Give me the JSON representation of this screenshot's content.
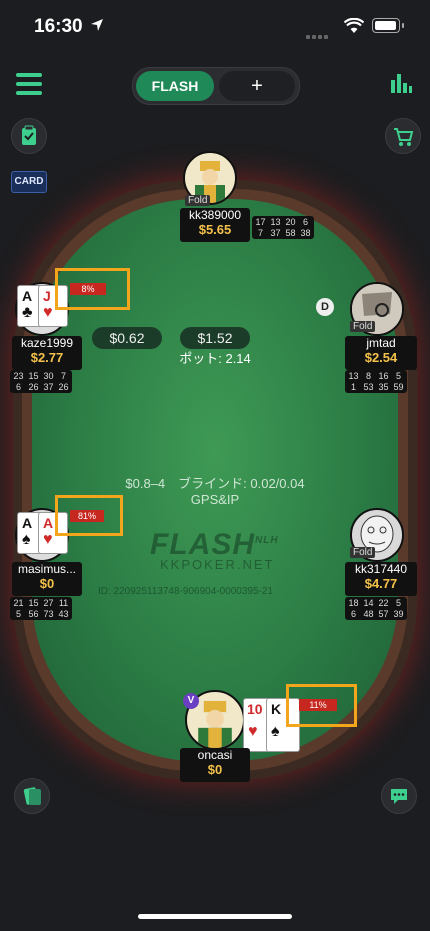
{
  "status_bar": {
    "time": "16:30"
  },
  "top_bar": {
    "tab_flash": "FLASH",
    "tab_add": "+",
    "card_badge": "CARD"
  },
  "table": {
    "pot_left": "$0.62",
    "pot_right": "$1.52",
    "pot_label": "ポット: 2.14",
    "blinds": "$0.8–4　ブラインド: 0.02/0.04",
    "gps": "GPS&IP",
    "logo": "FLASH",
    "logo_tag": "NLH",
    "logo_sub": "KKPOKER.NET",
    "game_id": "ID: 220925113748-906904-0000395-21",
    "dealer": "D"
  },
  "players": {
    "top": {
      "name": "kk389000",
      "stack": "$5.65",
      "fold": "Fold",
      "stats": [
        "17",
        "13",
        "20",
        "6",
        "7",
        "37",
        "58",
        "38"
      ]
    },
    "left_upper": {
      "name": "kaze1999",
      "stack": "$2.77",
      "equity": "8%",
      "stats": [
        "23",
        "15",
        "30",
        "7",
        "6",
        "26",
        "37",
        "26"
      ],
      "cards": [
        {
          "rank": "A",
          "suit": "♣"
        },
        {
          "rank": "J",
          "suit": "♥"
        }
      ]
    },
    "right_upper": {
      "name": "jmtad",
      "stack": "$2.54",
      "fold": "Fold",
      "stats": [
        "13",
        "8",
        "16",
        "5",
        "1",
        "53",
        "35",
        "59"
      ]
    },
    "left_lower": {
      "name": "masimus...",
      "stack": "$0",
      "equity": "81%",
      "stats": [
        "21",
        "15",
        "27",
        "11",
        "5",
        "56",
        "73",
        "43"
      ],
      "cards": [
        {
          "rank": "A",
          "suit": "♠"
        },
        {
          "rank": "A",
          "suit": "♥"
        }
      ]
    },
    "right_lower": {
      "name": "kk317440",
      "stack": "$4.77",
      "fold": "Fold",
      "stats": [
        "18",
        "14",
        "22",
        "5",
        "6",
        "48",
        "57",
        "39"
      ]
    },
    "hero": {
      "name": "oncasi",
      "stack": "$0",
      "equity": "11%",
      "vip": "V",
      "cards": [
        {
          "rank": "10",
          "suit": "♥"
        },
        {
          "rank": "K",
          "suit": "♠"
        }
      ]
    }
  }
}
